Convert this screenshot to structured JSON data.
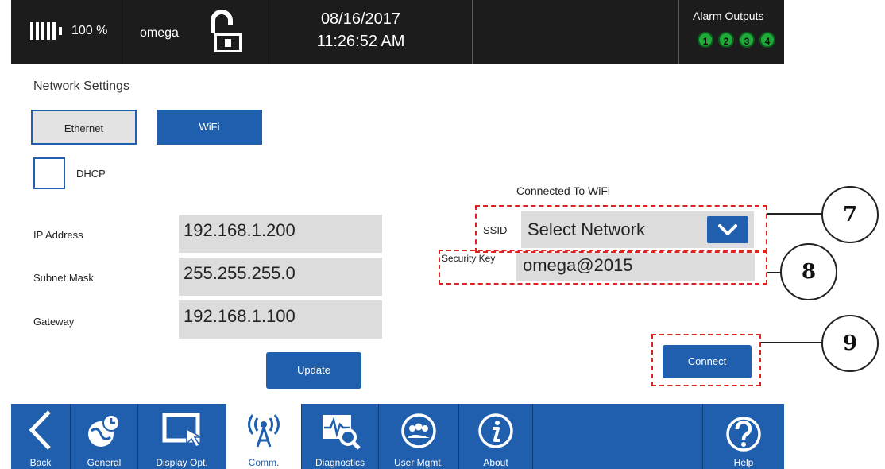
{
  "status_bar": {
    "battery_percent": "100 %",
    "user": "omega",
    "date": "08/16/2017",
    "time": "11:26:52 AM",
    "lock_state": "unlocked-padlock-icon",
    "alarm_outputs_label": "Alarm Outputs",
    "alarms": [
      "1",
      "2",
      "3",
      "4"
    ]
  },
  "page": {
    "title": "Network Settings"
  },
  "tabs": [
    {
      "label": "Ethernet",
      "selected": false
    },
    {
      "label": "WiFi",
      "selected": true
    }
  ],
  "dhcp": {
    "label": "DHCP",
    "checked": false
  },
  "ethernet_fields": [
    {
      "label": "IP Address",
      "value": "192.168.1.200"
    },
    {
      "label": "Subnet Mask",
      "value": "255.255.255.0"
    },
    {
      "label": "Gateway",
      "value": "192.168.1.100"
    }
  ],
  "update_button": "Update",
  "wifi": {
    "status": "Connected To WiFi",
    "ssid_label": "SSID",
    "ssid_value": "Select Network",
    "security_key_label": "Security Key",
    "security_key_value": "omega@2015",
    "connect_button": "Connect"
  },
  "callouts": [
    "7",
    "8",
    "9"
  ],
  "nav": [
    {
      "label": "Back",
      "icon": "back-arrow-icon"
    },
    {
      "label": "General",
      "icon": "globe-clock-icon"
    },
    {
      "label": "Display Opt.",
      "icon": "touch-screen-icon"
    },
    {
      "label": "Comm.",
      "icon": "antenna-icon",
      "active": true
    },
    {
      "label": "Diagnostics",
      "icon": "diagnostics-icon"
    },
    {
      "label": "User Mgmt.",
      "icon": "users-icon"
    },
    {
      "label": "About",
      "icon": "info-icon"
    },
    {
      "label": "Help",
      "icon": "help-icon"
    }
  ],
  "colors": {
    "primary_blue": "#1f5fad",
    "top_bar": "#1c1c1c",
    "alarm_green": "#1faa3a",
    "field_gray": "#dcdcdc",
    "callout_red": "#dd2222"
  }
}
